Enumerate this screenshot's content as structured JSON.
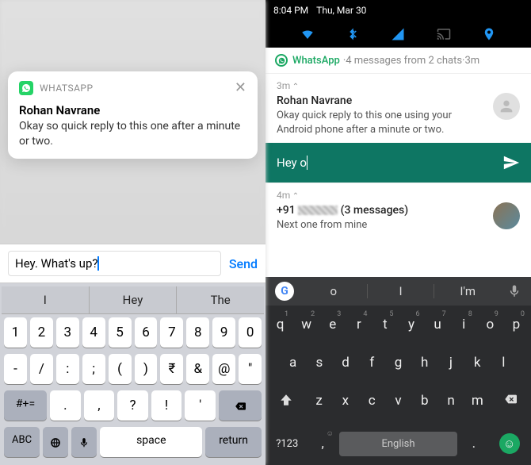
{
  "ios": {
    "notification": {
      "app_name": "WHATSAPP",
      "sender": "Rohan Navrane",
      "message": "Okay so quick reply to this one after a minute or two."
    },
    "input": {
      "text": "Hey. What's up?",
      "send_label": "Send"
    },
    "keyboard": {
      "suggestions": [
        "I",
        "Hey",
        "The"
      ],
      "row1": [
        "1",
        "2",
        "3",
        "4",
        "5",
        "6",
        "7",
        "8",
        "9",
        "0"
      ],
      "row2": [
        "-",
        "/",
        ":",
        ";",
        "(",
        ")",
        "₹",
        "&",
        "@",
        "\""
      ],
      "row3_sym": "#+=",
      "row3": [
        ".",
        ",",
        "?",
        "!",
        "'"
      ],
      "row4_abc": "ABC",
      "row4_space": "space",
      "row4_return": "return"
    }
  },
  "android": {
    "status": {
      "time": "8:04 PM",
      "date": "Thu, Mar 30"
    },
    "header": {
      "app": "WhatsApp",
      "summary": "4 messages from 2 chats",
      "age": "3m"
    },
    "notif1": {
      "age": "3m",
      "sender": "Rohan Navrane",
      "message": "Okay quick reply to this one using your Android phone after a minute or two."
    },
    "reply": {
      "text": "Hey o"
    },
    "notif2": {
      "age": "4m",
      "sender_prefix": "+91 ",
      "sender_suffix": " (3 messages)",
      "message": "Next one from mine"
    },
    "keyboard": {
      "suggestions": [
        "o",
        "I",
        "I'm"
      ],
      "row1": [
        "q",
        "w",
        "e",
        "r",
        "t",
        "y",
        "u",
        "i",
        "o",
        "p"
      ],
      "row1_nums": [
        "1",
        "2",
        "3",
        "4",
        "5",
        "6",
        "7",
        "8",
        "9",
        "0"
      ],
      "row2": [
        "a",
        "s",
        "d",
        "f",
        "g",
        "h",
        "j",
        "k",
        "l"
      ],
      "row3": [
        "z",
        "x",
        "c",
        "v",
        "b",
        "n",
        "m"
      ],
      "sym": "?123",
      "space": "English"
    }
  }
}
